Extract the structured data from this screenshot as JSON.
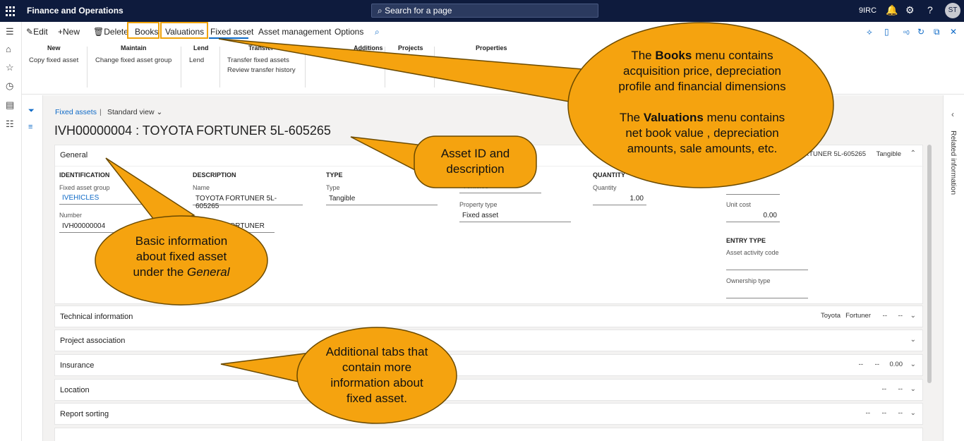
{
  "app": {
    "title": "Finance and Operations",
    "search_placeholder": "Search for a page",
    "company": "9IRC",
    "user_initials": "ST",
    "notification_count": "0"
  },
  "actions": {
    "edit": "Edit",
    "new": "New",
    "delete": "Delete",
    "tabs": [
      "Books",
      "Valuations",
      "Fixed asset",
      "Asset management",
      "Options"
    ]
  },
  "ribbon": {
    "groups": [
      {
        "header": "New",
        "items": [
          "Copy fixed asset"
        ]
      },
      {
        "header": "Maintain",
        "items": [
          "Change fixed asset group"
        ]
      },
      {
        "header": "Lend",
        "items": [
          "Lend"
        ]
      },
      {
        "header": "Transfer",
        "items": [
          "Transfer fixed assets",
          "Review transfer history"
        ]
      },
      {
        "header": "Additions",
        "items": []
      },
      {
        "header": "Projects",
        "items": []
      },
      {
        "header": "Properties",
        "items": []
      }
    ]
  },
  "breadcrumb": {
    "link": "Fixed assets",
    "sep": "|",
    "view": "Standard view"
  },
  "page_title": "IVH00000004 : TOYOTA FORTUNER 5L-605265",
  "general": {
    "title": "General",
    "summary": "TOYOTA FORTUNER 5L-605265",
    "summary_type": "Tangible",
    "identification": {
      "header": "IDENTIFICATION",
      "group_label": "Fixed asset group",
      "group_value": "IVEHICLES",
      "number_label": "Number",
      "number_value": "IVH00000004"
    },
    "description": {
      "header": "DESCRIPTION",
      "name_label": "Name",
      "name_value": "TOYOTA FORTUNER 5L-605265",
      "search_value": "TOYOTA FORTUNER ..."
    },
    "type": {
      "header": "TYPE",
      "type_label": "Type",
      "type_value": "Tangible"
    },
    "col4": {
      "group_value": "Vehicles",
      "property_label": "Property type",
      "property_value": "Fixed asset"
    },
    "quantity": {
      "header": "QUANTITY",
      "qty_label": "Quantity",
      "qty_value": "1.00"
    },
    "cost": {
      "unit_label": "Unit cost",
      "unit_value": "0.00"
    },
    "entry": {
      "header": "ENTRY TYPE",
      "activity_label": "Asset activity code",
      "ownership_label": "Ownership type"
    }
  },
  "tabs": [
    {
      "title": "Technical information",
      "summary": [
        "Toyota",
        "Fortuner",
        "--",
        "--"
      ]
    },
    {
      "title": "Project association",
      "summary": []
    },
    {
      "title": "Insurance",
      "summary": [
        "--",
        "--",
        "0.00"
      ]
    },
    {
      "title": "Location",
      "summary": [
        "--",
        "--"
      ]
    },
    {
      "title": "Report sorting",
      "summary": [
        "--",
        "--",
        "--"
      ]
    }
  ],
  "right_pane": {
    "label": "Related information"
  },
  "callouts": {
    "books": {
      "line1_pre": "The ",
      "line1_bold": "Books",
      "line1_post": " menu contains",
      "line2": "acquisition price, depreciation",
      "line3": "profile and financial dimensions",
      "line4_pre": "The ",
      "line4_bold": "Valuations",
      "line4_post": " menu contains",
      "line5": "net book value , depreciation",
      "line6": "amounts, sale  amounts, etc."
    },
    "asset_id": {
      "line1": "Asset ID and",
      "line2": "description"
    },
    "basic": {
      "line1": "Basic information",
      "line2": "about fixed asset",
      "line3_pre": "under the ",
      "line3_italic": "General"
    },
    "tabs": {
      "line1": "Additional tabs that",
      "line2": "contain more",
      "line3": "information about",
      "line4": "fixed asset."
    }
  },
  "colors": {
    "topbar": "#0e1b3d",
    "accent": "#0e6ac7",
    "callout_fill": "#f5a30f",
    "highlight": "#f0a30a"
  }
}
